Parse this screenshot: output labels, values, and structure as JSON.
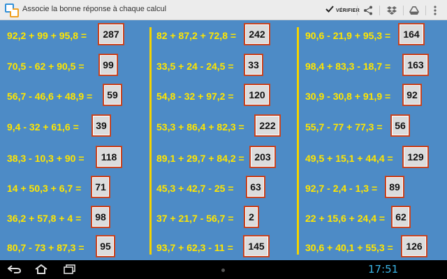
{
  "app": {
    "title": "Associe la bonne réponse à chaque calcul",
    "verify_label": "VÉRIFIER"
  },
  "colors": {
    "background": "#4d8bc6",
    "calc_text": "#ffe600",
    "divider": "#f4d300",
    "answer_border": "#c8431f",
    "answer_fill": "#dcdcdc"
  },
  "icons": {
    "app": "app-icon",
    "verify": "check-icon",
    "share": "share-icon",
    "dropbox": "dropbox-icon",
    "drive": "drive-icon",
    "overflow": "overflow-menu-icon",
    "back": "back-icon",
    "home": "home-icon",
    "recents": "recents-icon"
  },
  "columns": [
    {
      "calcs": [
        "92,2 + 99 + 95,8 =",
        "70,5 - 62 + 90,5 =",
        "56,7 - 46,6 + 48,9 =",
        "9,4 - 32 + 61,6 =",
        "38,3 - 10,3 + 90 =",
        "14 + 50,3 + 6,7 =",
        "36,2 + 57,8 + 4 =",
        "80,7 - 73 + 87,3 ="
      ],
      "answers": [
        "287",
        "99",
        "59",
        "39",
        "118",
        "71",
        "98",
        "95"
      ]
    },
    {
      "calcs": [
        "82 + 87,2 + 72,8 =",
        "33,5 + 24 - 24,5 =",
        "54,8 - 32 + 97,2 =",
        "53,3 + 86,4 + 82,3 =",
        "89,1 + 29,7 + 84,2 =",
        "45,3 + 42,7 - 25 =",
        "37 + 21,7 - 56,7 =",
        "93,7 + 62,3 - 11 ="
      ],
      "answers": [
        "242",
        "33",
        "120",
        "222",
        "203",
        "63",
        "2",
        "145"
      ]
    },
    {
      "calcs": [
        "90,6 - 21,9 + 95,3 =",
        "98,4 + 83,3 - 18,7 =",
        "30,9 - 30,8 + 91,9 =",
        "55,7 - 77 + 77,3 =",
        "49,5 + 15,1 + 44,4 =",
        "92,7 - 2,4 - 1,3 =",
        "22 + 15,6 + 24,4 =",
        "30,6 + 40,1 + 55,3 ="
      ],
      "answers": [
        "164",
        "163",
        "92",
        "56",
        "129",
        "89",
        "62",
        "126"
      ]
    }
  ],
  "status": {
    "time": "17:51"
  }
}
